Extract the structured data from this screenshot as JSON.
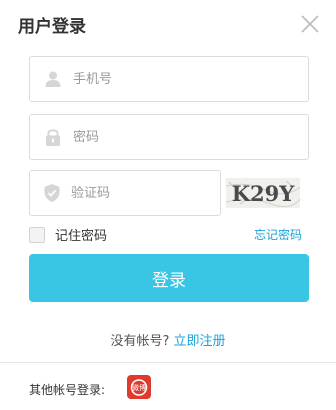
{
  "header": {
    "title": "用户登录"
  },
  "form": {
    "phone_placeholder": "手机号",
    "password_placeholder": "密码",
    "captcha_placeholder": "验证码",
    "captcha_text": "K29Y",
    "remember_label": "记住密码",
    "forgot_label": "忘记密码",
    "submit_label": "登录"
  },
  "footer": {
    "no_account": "没有帐号?",
    "register_label": "立即注册",
    "other_login": "其他帐号登录:",
    "social_label": "微博"
  },
  "colors": {
    "accent": "#38c6e4",
    "link": "#1aa3d8"
  }
}
